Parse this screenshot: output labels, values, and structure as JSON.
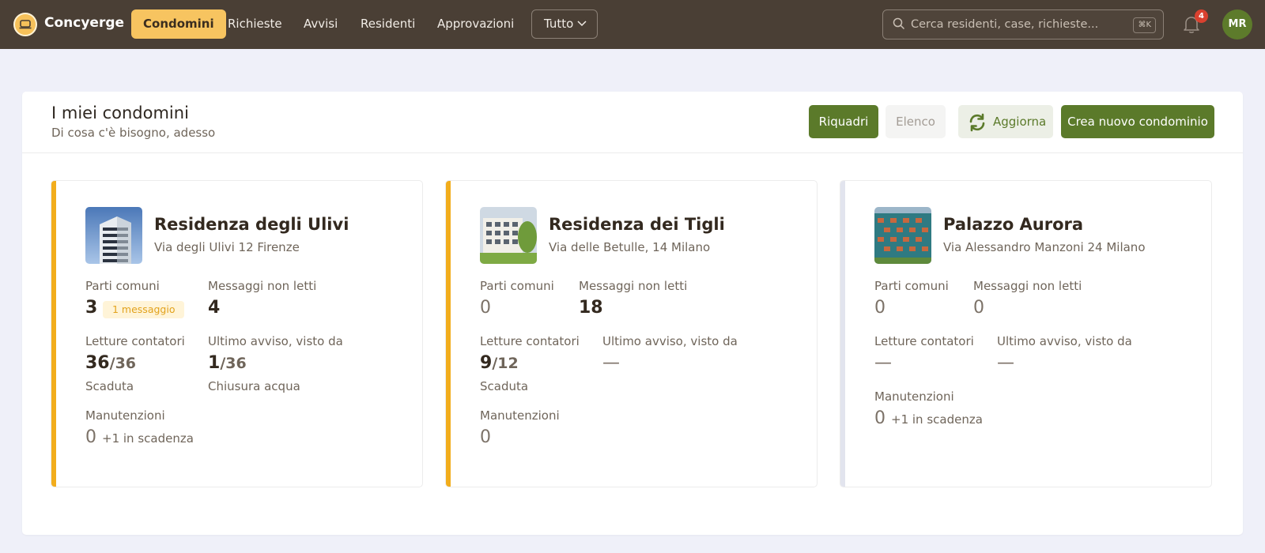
{
  "app": {
    "brand": "Concyerge"
  },
  "nav": {
    "items": [
      "Condomini",
      "Richieste",
      "Avvisi",
      "Residenti",
      "Approvazioni"
    ],
    "filter": "Tutto"
  },
  "search": {
    "placeholder": "Cerca residenti, case, richieste...",
    "shortcut": "⌘K"
  },
  "notifications": {
    "count": "4"
  },
  "user": {
    "initials": "MR"
  },
  "page": {
    "title": "I miei condomini",
    "subtitle": "Di cosa c'è bisogno, adesso",
    "buttons": {
      "grid": "Riquadri",
      "list": "Elenco",
      "refresh": "Aggiorna",
      "create": "Crea nuovo condominio"
    }
  },
  "labels": {
    "common": "Parti comuni",
    "unread": "Messaggi non letti",
    "meters": "Letture contatori",
    "last_notice": "Ultimo avviso, visto da",
    "maintenance": "Manutenzioni"
  },
  "colors": {
    "accent": "#5b7a2a",
    "warning": "#f2ad1c",
    "topbar": "#4a3f35"
  },
  "buildings": [
    {
      "name": "Residenza degli Ulivi",
      "address": "Via degli Ulivi 12 Firenze",
      "common": "3",
      "common_pill": "1 messaggio",
      "unread": "4",
      "meters": "36",
      "meters_total": "/36",
      "meters_sub": "Scaduta",
      "notice": "1",
      "notice_total": "/36",
      "notice_sub": "Chiusura acqua",
      "maintenance": "0",
      "maintenance_extra": "+1 in scadenza"
    },
    {
      "name": "Residenza dei Tigli",
      "address": "Via delle Betulle, 14 Milano",
      "common": "0",
      "unread": "18",
      "meters": "9",
      "meters_total": "/12",
      "meters_sub": "Scaduta",
      "notice": "—",
      "maintenance": "0"
    },
    {
      "name": "Palazzo Aurora",
      "address": "Via Alessandro Manzoni 24 Milano",
      "common": "0",
      "unread": "0",
      "meters": "—",
      "notice": "—",
      "maintenance": "0",
      "maintenance_extra": "+1 in scadenza"
    }
  ]
}
